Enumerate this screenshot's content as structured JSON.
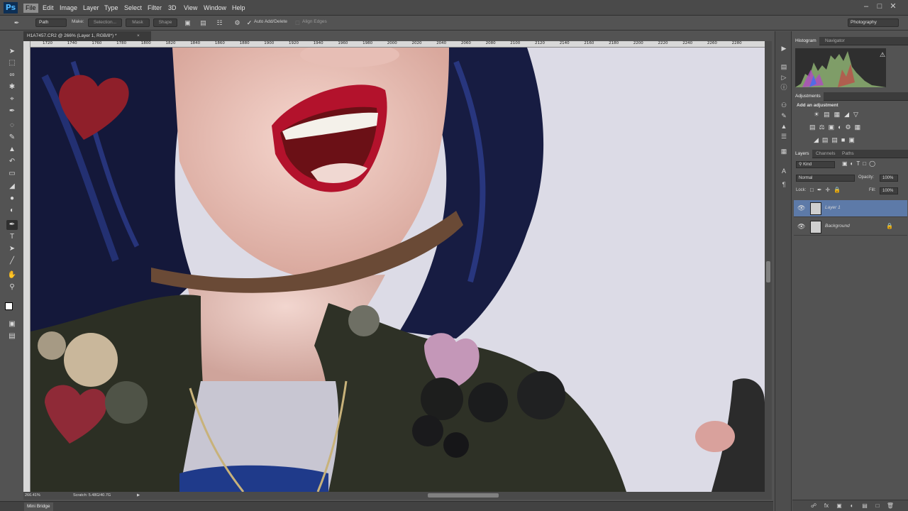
{
  "app": {
    "logo": "Ps"
  },
  "menu": [
    "File",
    "Edit",
    "Image",
    "Layer",
    "Type",
    "Select",
    "Filter",
    "3D",
    "View",
    "Window",
    "Help"
  ],
  "options": {
    "mode_value": "Path",
    "make_label": "Make:",
    "selection_btn": "Selection...",
    "mask_btn": "Mask",
    "shape_btn": "Shape",
    "auto_add_delete": "Auto Add/Delete",
    "align_edges": "Align Edges",
    "workspace": "Photography"
  },
  "document": {
    "tab_title": "H1A7457.CR2 @ 266% (Layer 1, RGB/8*) *",
    "ruler_ticks": [
      "1720",
      "1740",
      "1760",
      "1780",
      "1800",
      "1820",
      "1840",
      "1860",
      "1880",
      "1900",
      "1920",
      "1940",
      "1960",
      "1980",
      "2000",
      "2020",
      "2040",
      "2060",
      "2080",
      "2100",
      "2120",
      "2140",
      "2160",
      "2180",
      "2200",
      "2220",
      "2240",
      "2260",
      "2280"
    ],
    "zoom": "266.41%",
    "scratch": "Scratch: 5.48G/40.7G"
  },
  "bottom": {
    "mini_bridge": "Mini Bridge"
  },
  "panels": {
    "histogram_tab": "Histogram",
    "navigator_tab": "Navigator",
    "adjustments_tab": "Adjustments",
    "add_adjustment": "Add an adjustment",
    "layers_tab": "Layers",
    "channels_tab": "Channels",
    "paths_tab": "Paths",
    "kind_filter": "Kind",
    "blend_mode": "Normal",
    "opacity_label": "Opacity:",
    "opacity_value": "100%",
    "lock_label": "Lock:",
    "fill_label": "Fill:",
    "fill_value": "100%",
    "layers": [
      {
        "name": "Layer 1",
        "selected": true
      },
      {
        "name": "Background",
        "selected": false
      }
    ]
  },
  "colors": {
    "accent_selected_layer": "#5d7aa8",
    "menu_active": "#8e8e8e"
  }
}
